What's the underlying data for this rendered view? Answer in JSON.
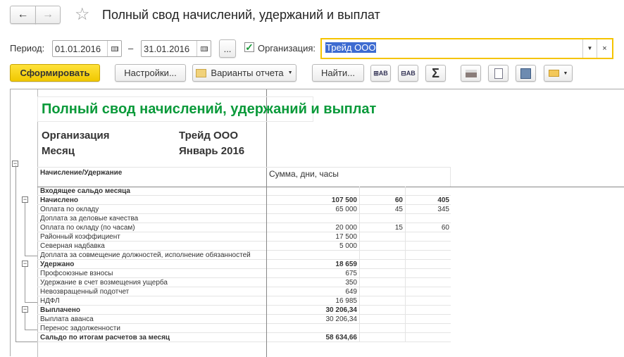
{
  "window": {
    "title": "Полный свод начислений, удержаний и выплат"
  },
  "filters": {
    "period_label": "Период:",
    "date_from": "01.01.2016",
    "dash": "–",
    "date_to": "31.01.2016",
    "more_label": "...",
    "org_checkbox_checked": true,
    "org_label": "Организация:",
    "org_value": "Трейд ООО"
  },
  "toolbar": {
    "generate": "Сформировать",
    "settings": "Настройки...",
    "variants": "Варианты отчета",
    "find": "Найти...",
    "sum": "Σ"
  },
  "colors": {
    "accent_yellow": "#f5d000",
    "title_green": "#0a9a3a",
    "selection": "#3d6bd1"
  },
  "report": {
    "title": "Полный свод начислений, удержаний и выплат",
    "org_label": "Организация",
    "org_value": "Трейд ООО",
    "month_label": "Месяц",
    "month_value": "Январь 2016",
    "col_header": "Начисление/Удержание",
    "sum_header": "Сумма, дни, часы",
    "rows": [
      {
        "name": "Входящее сальдо месяца",
        "sum": "",
        "days": "",
        "hours": "",
        "bold": true
      },
      {
        "name": "Начислено",
        "sum": "107 500",
        "days": "60",
        "hours": "405",
        "bold": true
      },
      {
        "name": "Оплата по окладу",
        "sum": "65 000",
        "days": "45",
        "hours": "345"
      },
      {
        "name": "Доплата за деловые качества",
        "sum": "",
        "days": "",
        "hours": ""
      },
      {
        "name": "Оплата по окладу (по часам)",
        "sum": "20 000",
        "days": "15",
        "hours": "60"
      },
      {
        "name": "Районный коэффициент",
        "sum": "17 500",
        "days": "",
        "hours": ""
      },
      {
        "name": "Северная надбавка",
        "sum": "5 000",
        "days": "",
        "hours": ""
      },
      {
        "name": "Доплата за совмещение должностей, исполнение обязанностей",
        "sum": "",
        "days": "",
        "hours": ""
      },
      {
        "name": "Удержано",
        "sum": "18 659",
        "days": "",
        "hours": "",
        "bold": true
      },
      {
        "name": "Профсоюзные взносы",
        "sum": "675",
        "days": "",
        "hours": ""
      },
      {
        "name": "Удержание в счет возмещения ущерба",
        "sum": "350",
        "days": "",
        "hours": ""
      },
      {
        "name": "Невозвращенный подотчет",
        "sum": "649",
        "days": "",
        "hours": ""
      },
      {
        "name": "НДФЛ",
        "sum": "16 985",
        "days": "",
        "hours": ""
      },
      {
        "name": "Выплачено",
        "sum": "30 206,34",
        "days": "",
        "hours": "",
        "bold": true
      },
      {
        "name": "Выплата аванса",
        "sum": "30 206,34",
        "days": "",
        "hours": ""
      },
      {
        "name": "Перенос задолженности",
        "sum": "",
        "days": "",
        "hours": ""
      },
      {
        "name": "Сальдо по итогам расчетов за месяц",
        "sum": "58 634,66",
        "days": "",
        "hours": "",
        "bold": true
      }
    ]
  }
}
